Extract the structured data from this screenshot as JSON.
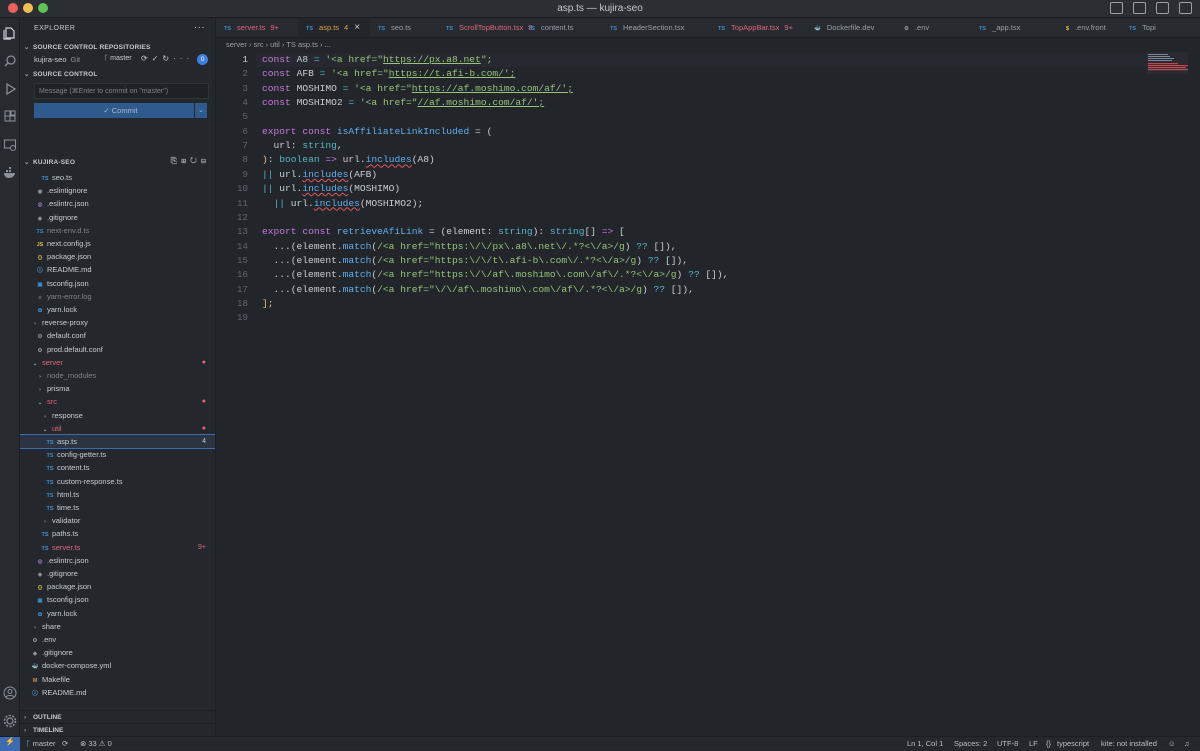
{
  "window": {
    "title": "asp.ts — kujira-seo"
  },
  "explorer": {
    "title": "EXPLORER",
    "more": "···"
  },
  "scm_repos": {
    "title": "SOURCE CONTROL REPOSITORIES",
    "repo": "kujira-seo",
    "kind": "Git",
    "branch": "master",
    "badge": "0"
  },
  "scm": {
    "title": "SOURCE CONTROL",
    "placeholder": "Message (⌘Enter to commit on \"master\")",
    "commit_label": "✓ Commit"
  },
  "workspace": {
    "title": "KUJIRA-SEO"
  },
  "tree": [
    {
      "label": "seo.ts",
      "icon": "TS",
      "color": "#3d8fd1",
      "indent": 2
    },
    {
      "label": ".eslintignore",
      "icon": "◉",
      "color": "#8c929a",
      "indent": 1
    },
    {
      "label": ".eslintrc.json",
      "icon": "◎",
      "color": "#a57fd6",
      "indent": 1
    },
    {
      "label": ".gitignore",
      "icon": "◆",
      "color": "#8c929a",
      "indent": 1
    },
    {
      "label": "next-env.d.ts",
      "icon": "TS",
      "color": "#3d8fd1",
      "indent": 1,
      "muted": true
    },
    {
      "label": "next.config.js",
      "icon": "JS",
      "color": "#e2c04a",
      "indent": 1
    },
    {
      "label": "package.json",
      "icon": "{}",
      "color": "#e2c04a",
      "indent": 1
    },
    {
      "label": "README.md",
      "icon": "ⓘ",
      "color": "#4aa3e0",
      "indent": 1
    },
    {
      "label": "tsconfig.json",
      "icon": "▣",
      "color": "#3d8fd1",
      "indent": 1
    },
    {
      "label": "yarn-error.log",
      "icon": "≡",
      "color": "#8c929a",
      "indent": 1,
      "muted": true
    },
    {
      "label": "yarn.lock",
      "icon": "✿",
      "color": "#3d8fd1",
      "indent": 1
    },
    {
      "label": "reverse-proxy",
      "icon": "›",
      "color": "#9aa0a8",
      "indent": 0
    },
    {
      "label": "default.conf",
      "icon": "⚙",
      "color": "#8c929a",
      "indent": 1
    },
    {
      "label": "prod.default.conf",
      "icon": "⚙",
      "color": "#8c929a",
      "indent": 1
    },
    {
      "label": "server",
      "icon": "⌄",
      "color": "#9aa0a8",
      "indent": 0,
      "mod": true,
      "mark": "●"
    },
    {
      "label": "node_modules",
      "icon": "›",
      "color": "#9aa0a8",
      "indent": 1,
      "muted": true
    },
    {
      "label": "prisma",
      "icon": "›",
      "color": "#9aa0a8",
      "indent": 1
    },
    {
      "label": "src",
      "icon": "⌄",
      "color": "#9aa0a8",
      "indent": 1,
      "mod": true,
      "mark": "●"
    },
    {
      "label": "response",
      "icon": "›",
      "color": "#9aa0a8",
      "indent": 2
    },
    {
      "label": "util",
      "icon": "⌄",
      "color": "#9aa0a8",
      "indent": 2,
      "mod": true,
      "mark": "●"
    },
    {
      "label": "asp.ts",
      "icon": "TS",
      "color": "#3d8fd1",
      "indent": 3,
      "selected": true,
      "mark": "4"
    },
    {
      "label": "config-getter.ts",
      "icon": "TS",
      "color": "#3d8fd1",
      "indent": 3
    },
    {
      "label": "content.ts",
      "icon": "TS",
      "color": "#3d8fd1",
      "indent": 3
    },
    {
      "label": "custom-response.ts",
      "icon": "TS",
      "color": "#3d8fd1",
      "indent": 3
    },
    {
      "label": "html.ts",
      "icon": "TS",
      "color": "#3d8fd1",
      "indent": 3
    },
    {
      "label": "time.ts",
      "icon": "TS",
      "color": "#3d8fd1",
      "indent": 3
    },
    {
      "label": "validator",
      "icon": "›",
      "color": "#9aa0a8",
      "indent": 2
    },
    {
      "label": "paths.ts",
      "icon": "TS",
      "color": "#3d8fd1",
      "indent": 2
    },
    {
      "label": "server.ts",
      "icon": "TS",
      "color": "#3d8fd1",
      "indent": 2,
      "mod": true,
      "mark": "9+"
    },
    {
      "label": ".eslintrc.json",
      "icon": "◎",
      "color": "#a57fd6",
      "indent": 1
    },
    {
      "label": ".gitignore",
      "icon": "◆",
      "color": "#8c929a",
      "indent": 1
    },
    {
      "label": "package.json",
      "icon": "{}",
      "color": "#e2c04a",
      "indent": 1
    },
    {
      "label": "tsconfig.json",
      "icon": "▣",
      "color": "#3d8fd1",
      "indent": 1
    },
    {
      "label": "yarn.lock",
      "icon": "✿",
      "color": "#3d8fd1",
      "indent": 1
    },
    {
      "label": "share",
      "icon": "›",
      "color": "#9aa0a8",
      "indent": 0
    },
    {
      "label": ".env",
      "icon": "⚙",
      "color": "#8c929a",
      "indent": 0
    },
    {
      "label": ".gitignore",
      "icon": "◆",
      "color": "#8c929a",
      "indent": 0
    },
    {
      "label": "docker-compose.yml",
      "icon": "🐳",
      "color": "#e0667a",
      "indent": 0
    },
    {
      "label": "Makefile",
      "icon": "M",
      "color": "#e08a3a",
      "indent": 0
    },
    {
      "label": "README.md",
      "icon": "ⓘ",
      "color": "#4aa3e0",
      "indent": 0
    }
  ],
  "outline": "OUTLINE",
  "timeline": "TIMELINE",
  "tabs": [
    {
      "label": "server.ts",
      "icon": "TS",
      "badge": "9+",
      "mod": true
    },
    {
      "label": "asp.ts",
      "icon": "TS",
      "badge": "4",
      "active": true,
      "close": "×"
    },
    {
      "label": "seo.ts",
      "icon": "TS"
    },
    {
      "label": "ScrollTopButton.tsx",
      "icon": "TS",
      "badge": "3",
      "mod": true
    },
    {
      "label": "content.ts",
      "icon": "TS"
    },
    {
      "label": "HeaderSection.tsx",
      "icon": "TS"
    },
    {
      "label": "TopAppBar.tsx",
      "icon": "TS",
      "badge": "9+",
      "mod": true
    },
    {
      "label": "Dockerfile.dev",
      "icon": "🐳"
    },
    {
      "label": ".env",
      "icon": "⚙"
    },
    {
      "label": "_app.tsx",
      "icon": "TS"
    },
    {
      "label": ".env.front",
      "icon": "$"
    },
    {
      "label": "Topi",
      "icon": "TS"
    }
  ],
  "breadcrumb": "server › src › util › TS asp.ts › ...",
  "code": [
    "const A8 = '<a href=\"https://px.a8.net\";",
    "const AFB = '<a href=\"https://t.afi-b.com/';",
    "const MOSHIMO = '<a href=\"https://af.moshimo.com/af/';",
    "const MOSHIMO2 = '<a href=\"//af.moshimo.com/af/';",
    "",
    "export const isAffiliateLinkIncluded = (",
    "  url: string,",
    "): boolean => url.includes(A8)",
    "|| url.includes(AFB)",
    "|| url.includes(MOSHIMO)",
    "  || url.includes(MOSHIMO2);",
    "",
    "export const retrieveAfiLink = (element: string): string[] => [",
    "  ...(element.match(/<a href=\"https:\\/\\/px\\.a8\\.net\\/.*?<\\/a>/g) ?? []),",
    "  ...(element.match(/<a href=\"https:\\/\\/t\\.afi-b\\.com\\/.*?<\\/a>/g) ?? []),",
    "  ...(element.match(/<a href=\"https:\\/\\/af\\.moshimo\\.com\\/af\\/.*?<\\/a>/g) ?? []),",
    "  ...(element.match(/<a href=\"\\/\\/af\\.moshimo\\.com\\/af\\/.*?<\\/a>/g) ?? []),",
    "];",
    ""
  ],
  "line_numbers": [
    "1",
    "2",
    "3",
    "4",
    "5",
    "6",
    "7",
    "8",
    "9",
    "10",
    "11",
    "12",
    "13",
    "14",
    "15",
    "16",
    "17",
    "18",
    "19"
  ],
  "status": {
    "branch": "master",
    "problems": "⊗ 33 ⚠ 0",
    "position": "Ln 1, Col 1",
    "spaces": "Spaces: 2",
    "encoding": "UTF-8",
    "eol": "LF",
    "language": "typescript",
    "kite": "kite: not installed"
  },
  "colors": {
    "accent": "#3d6ab0",
    "modified": "#e0667a",
    "ts": "#3d8fd1",
    "tab_active": "#d6a24a"
  }
}
